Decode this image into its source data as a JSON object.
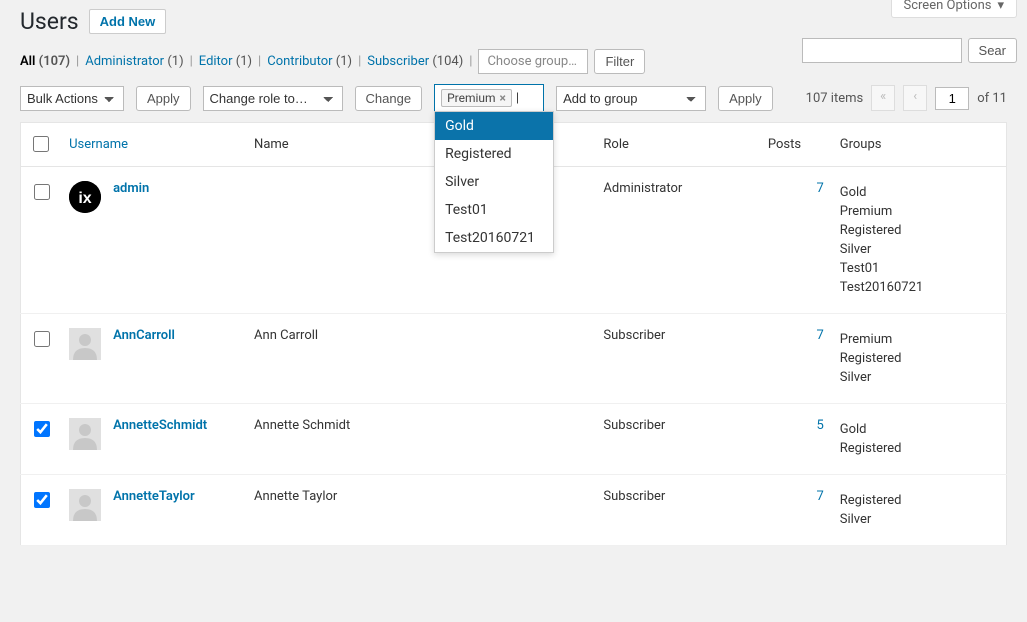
{
  "screen_options_label": "Screen Options",
  "page_title": "Users",
  "add_new_label": "Add New",
  "filters": {
    "all_label": "All",
    "all_count": "(107)",
    "admin_label": "Administrator",
    "admin_count": "(1)",
    "editor_label": "Editor",
    "editor_count": "(1)",
    "contributor_label": "Contributor",
    "contributor_count": "(1)",
    "subscriber_label": "Subscriber",
    "subscriber_count": "(104)",
    "choose_groups_placeholder": "Choose groups …",
    "filter_button": "Filter"
  },
  "search": {
    "value": "",
    "button": "Sear"
  },
  "bulk": {
    "actions_label": "Bulk Actions",
    "apply_label": "Apply",
    "change_role_label": "Change role to…",
    "change_label": "Change",
    "add_to_group_label": "Add to group",
    "apply2_label": "Apply"
  },
  "token": {
    "selected": "Premium"
  },
  "dropdown_options": {
    "o0": "Gold",
    "o1": "Registered",
    "o2": "Silver",
    "o3": "Test01",
    "o4": "Test20160721"
  },
  "pagination": {
    "items_text": "107 items",
    "current": "1",
    "of_text": "of 11"
  },
  "columns": {
    "username": "Username",
    "name": "Name",
    "role": "Role",
    "posts": "Posts",
    "groups": "Groups"
  },
  "rows": [
    {
      "checked": false,
      "avatar": "admin",
      "username": "admin",
      "name": "",
      "role": "Administrator",
      "posts": "7",
      "groups": [
        "Gold",
        "Premium",
        "Registered",
        "Silver",
        "Test01",
        "Test20160721"
      ]
    },
    {
      "checked": false,
      "avatar": "default",
      "username": "AnnCarroll",
      "name": "Ann Carroll",
      "role": "Subscriber",
      "posts": "7",
      "groups": [
        "Premium",
        "Registered",
        "Silver"
      ]
    },
    {
      "checked": true,
      "avatar": "default",
      "username": "AnnetteSchmidt",
      "name": "Annette Schmidt",
      "role": "Subscriber",
      "posts": "5",
      "groups": [
        "Gold",
        "Registered"
      ]
    },
    {
      "checked": true,
      "avatar": "default",
      "username": "AnnetteTaylor",
      "name": "Annette Taylor",
      "role": "Subscriber",
      "posts": "7",
      "groups": [
        "Registered",
        "Silver"
      ]
    }
  ]
}
